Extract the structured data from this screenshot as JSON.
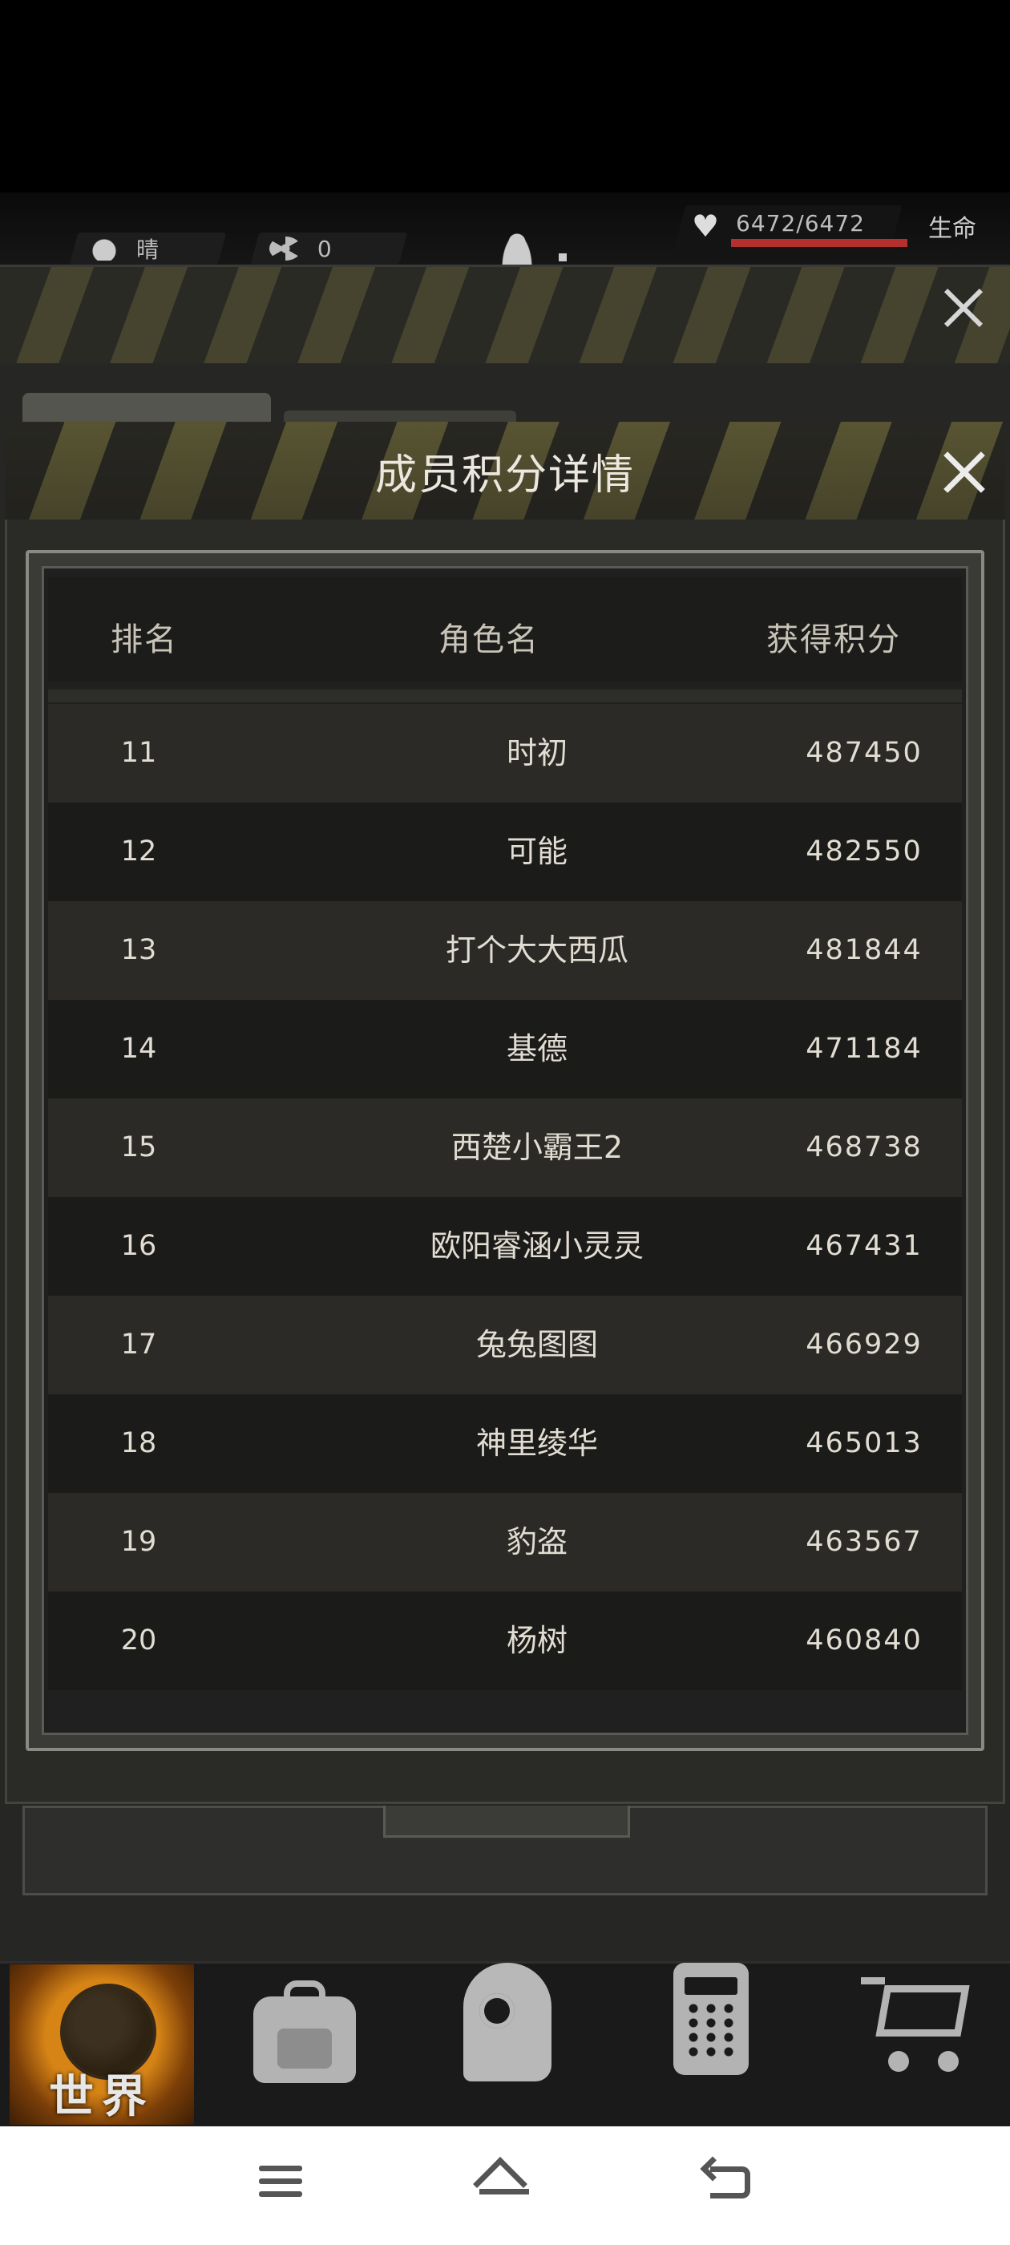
{
  "status": {
    "weather_label": "晴",
    "radiation_value": "0",
    "hp_text": "6472/6472",
    "hp_fraction": 1.0,
    "hp_label": "生命"
  },
  "modal": {
    "title": "成员积分详情",
    "columns": {
      "rank": "排名",
      "name": "角色名",
      "score": "获得积分"
    },
    "rows": [
      {
        "rank": "11",
        "name": "时初",
        "score": "487450"
      },
      {
        "rank": "12",
        "name": "可能",
        "score": "482550"
      },
      {
        "rank": "13",
        "name": "打个大大西瓜",
        "score": "481844"
      },
      {
        "rank": "14",
        "name": "基德",
        "score": "471184"
      },
      {
        "rank": "15",
        "name": "西楚小霸王2",
        "score": "468738"
      },
      {
        "rank": "16",
        "name": "欧阳睿涵小灵灵",
        "score": "467431"
      },
      {
        "rank": "17",
        "name": "兔兔图图",
        "score": "466929"
      },
      {
        "rank": "18",
        "name": "神里绫华",
        "score": "465013"
      },
      {
        "rank": "19",
        "name": "豹盗",
        "score": "463567"
      },
      {
        "rank": "20",
        "name": "杨树",
        "score": "460840"
      }
    ]
  },
  "game_nav": {
    "world_label": "世界",
    "items": [
      "world-icon",
      "backpack-icon",
      "skills-head-icon",
      "radio-icon",
      "shop-cart-icon"
    ]
  },
  "colors": {
    "accent_orange": "#d68416",
    "hp_red": "#b3302c",
    "hazard_yellow": "#6f6a3e"
  }
}
